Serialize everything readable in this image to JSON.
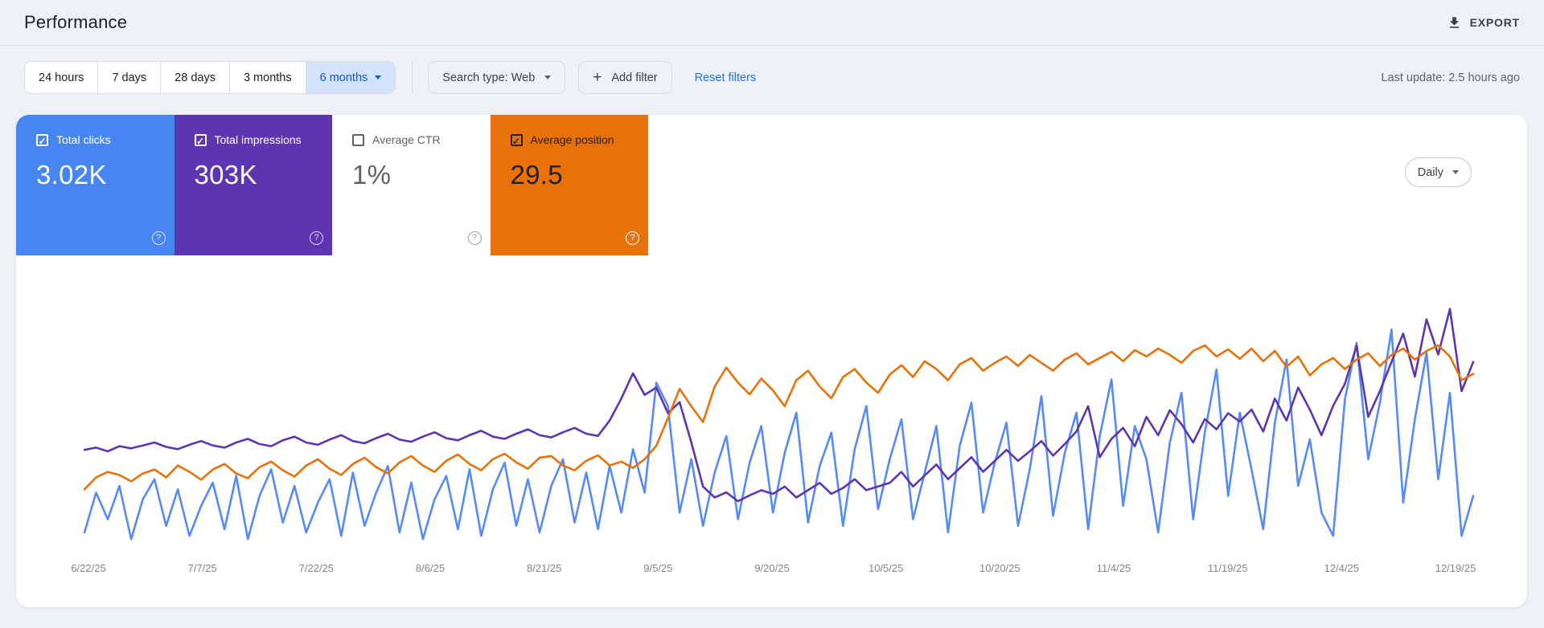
{
  "page": {
    "background": "#eef1f6",
    "panel_background": "#ffffff",
    "accent_blue": "#1a73e8"
  },
  "header": {
    "title": "Performance",
    "export_label": "EXPORT"
  },
  "filters": {
    "date_ranges": [
      {
        "label": "24 hours",
        "selected": false
      },
      {
        "label": "7 days",
        "selected": false
      },
      {
        "label": "28 days",
        "selected": false
      },
      {
        "label": "3 months",
        "selected": false
      },
      {
        "label": "6 months",
        "selected": true
      }
    ],
    "search_type_label": "Search type: Web",
    "add_filter_label": "Add filter",
    "plus_glyph": "+",
    "reset_label": "Reset filters",
    "last_update": "Last update: 2.5 hours ago"
  },
  "metrics": {
    "granularity_label": "Daily",
    "cards": [
      {
        "label": "Total clicks",
        "value": "3.02K",
        "checked": true,
        "background": "#4786f0",
        "text_color": "#ffffff",
        "help_color": "rgba(255,255,255,0.8)"
      },
      {
        "label": "Total impressions",
        "value": "303K",
        "checked": true,
        "background": "#5e35b1",
        "text_color": "#ffffff",
        "help_color": "rgba(255,255,255,0.8)"
      },
      {
        "label": "Average CTR",
        "value": "1%",
        "checked": false,
        "background": "#ffffff",
        "text_color": "#5f6368",
        "help_color": "#9aa0a6"
      },
      {
        "label": "Average position",
        "value": "29.5",
        "checked": true,
        "background": "#e8710a",
        "text_color": "#212121",
        "help_color": "#ffffff"
      }
    ]
  },
  "chart_data": {
    "type": "line",
    "title": "",
    "xlabel": "",
    "ylabel": "",
    "grid": false,
    "legend_position": "none (metric cards act as legend)",
    "x_tick_labels": [
      "6/22/25",
      "7/7/25",
      "7/22/25",
      "8/6/25",
      "8/21/25",
      "9/5/25",
      "9/20/25",
      "10/5/25",
      "10/20/25",
      "11/4/25",
      "11/19/25",
      "12/4/25",
      "12/19/25"
    ],
    "x_range_days": [
      "6/22/25",
      "12/19/25"
    ],
    "series": [
      {
        "name": "Total clicks",
        "unit": "clicks per day",
        "color": "#548bf4",
        "ylim": [
          0,
          76
        ],
        "inverted": false,
        "values": [
          6,
          18,
          10,
          20,
          4,
          16,
          22,
          8,
          19,
          5,
          14,
          21,
          7,
          23,
          4,
          17,
          25,
          9,
          20,
          6,
          15,
          22,
          5,
          24,
          8,
          18,
          26,
          6,
          21,
          4,
          16,
          23,
          7,
          25,
          5,
          19,
          27,
          8,
          22,
          6,
          20,
          28,
          9,
          24,
          7,
          26,
          12,
          31,
          18,
          51,
          44,
          12,
          28,
          8,
          24,
          35,
          10,
          27,
          38,
          12,
          30,
          42,
          9,
          26,
          36,
          8,
          31,
          44,
          13,
          28,
          40,
          10,
          24,
          38,
          6,
          32,
          45,
          12,
          27,
          39,
          8,
          25,
          47,
          11,
          30,
          42,
          7,
          35,
          52,
          14,
          38,
          28,
          6,
          33,
          48,
          10,
          36,
          55,
          17,
          42,
          25,
          7,
          39,
          58,
          20,
          34,
          12,
          5,
          46,
          63,
          28,
          45,
          67,
          15,
          40,
          60,
          22,
          48,
          5,
          17
        ]
      },
      {
        "name": "Total impressions",
        "unit": "impressions per day",
        "color": "#5e35b1",
        "ylim": [
          0,
          3450
        ],
        "inverted": false,
        "values": [
          1400,
          1430,
          1380,
          1450,
          1420,
          1460,
          1500,
          1440,
          1410,
          1470,
          1520,
          1460,
          1430,
          1500,
          1550,
          1480,
          1450,
          1530,
          1580,
          1500,
          1470,
          1540,
          1600,
          1520,
          1490,
          1560,
          1620,
          1540,
          1510,
          1580,
          1640,
          1560,
          1530,
          1600,
          1660,
          1580,
          1550,
          1620,
          1680,
          1600,
          1570,
          1640,
          1700,
          1620,
          1590,
          1800,
          2100,
          2445,
          2150,
          2250,
          1900,
          2050,
          1500,
          900,
          750,
          820,
          700,
          780,
          850,
          800,
          900,
          750,
          850,
          950,
          800,
          880,
          1000,
          850,
          900,
          950,
          1100,
          900,
          1050,
          1200,
          1000,
          1150,
          1300,
          1100,
          1250,
          1400,
          1250,
          1380,
          1520,
          1320,
          1480,
          1650,
          1996,
          1300,
          1550,
          1700,
          1450,
          1850,
          1600,
          1941,
          1750,
          1500,
          1820,
          1680,
          1900,
          1786,
          1950,
          1650,
          2100,
          1800,
          2250,
          1950,
          1600,
          2000,
          2300,
          2818,
          1850,
          2200,
          2600,
          2986,
          2400,
          3180,
          2700,
          3323,
          2200,
          2599
        ]
      },
      {
        "name": "Average position",
        "unit": "position (lower is better, axis inverted)",
        "color": "#e8710a",
        "ylim": [
          20,
          52
        ],
        "inverted": true,
        "values": [
          44,
          42.5,
          41.8,
          42.2,
          43,
          42,
          41.5,
          42.5,
          41,
          41.8,
          42.8,
          41.5,
          40.8,
          42,
          42.6,
          41.2,
          40.5,
          41.6,
          42.4,
          41,
          40.2,
          41.4,
          42.2,
          40.8,
          40,
          41.2,
          42,
          40.6,
          39.8,
          41,
          41.8,
          40.4,
          39.6,
          40.8,
          41.6,
          40.2,
          39.5,
          40.6,
          41.4,
          40,
          39.8,
          41,
          41.6,
          40.4,
          39.7,
          41,
          40.5,
          41.3,
          40.2,
          38.5,
          35,
          31.3,
          33.5,
          35.5,
          31,
          28.6,
          30.5,
          32,
          30,
          31.5,
          33.5,
          30.2,
          29,
          31,
          32.5,
          29.8,
          28.8,
          30.5,
          31.8,
          29.5,
          28.3,
          29.8,
          27.8,
          28.8,
          30.2,
          28.2,
          27.4,
          29,
          28,
          27.2,
          28.4,
          27,
          28,
          29,
          27.6,
          26.8,
          28.2,
          27.4,
          26.6,
          27.8,
          26.4,
          27.2,
          26.2,
          27,
          28,
          26.5,
          25.8,
          27.2,
          26.3,
          27.5,
          26.2,
          27.8,
          26.5,
          28.5,
          27.2,
          29.6,
          28.2,
          27.4,
          28.8,
          27.6,
          26.8,
          28.4,
          27,
          26.2,
          27.6,
          26.5,
          25.8,
          27.2,
          30.2,
          29.4
        ]
      }
    ]
  }
}
